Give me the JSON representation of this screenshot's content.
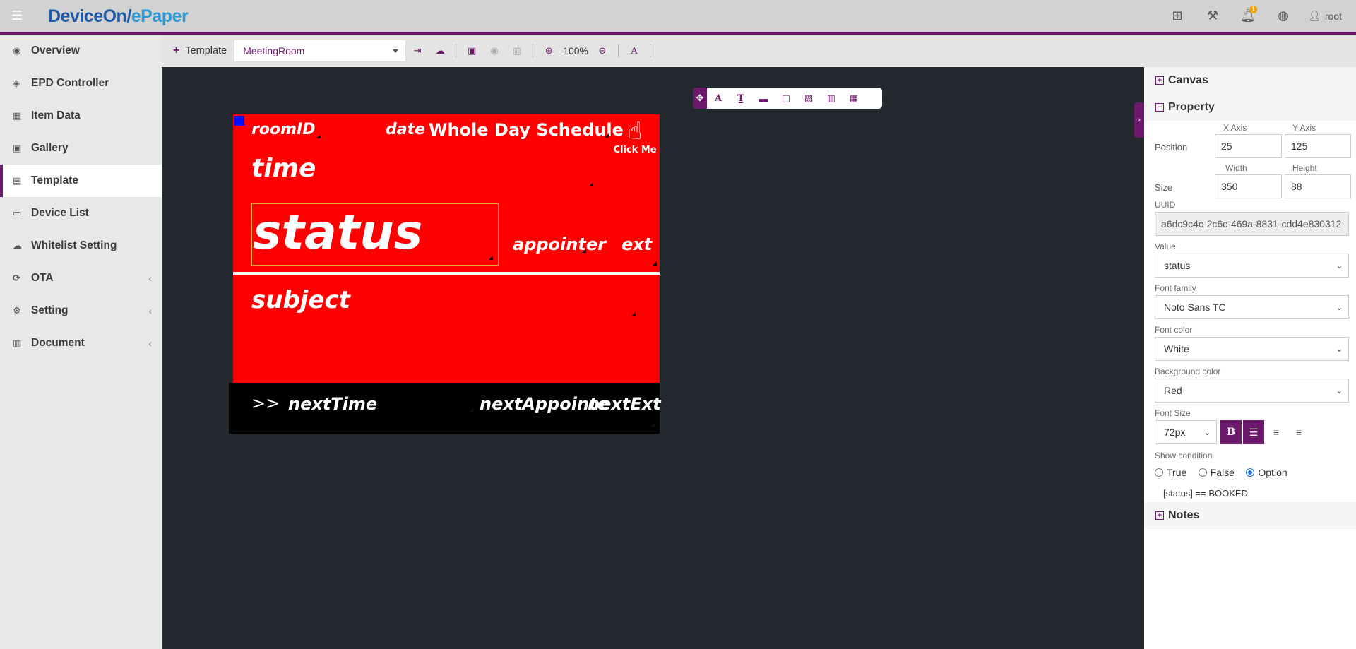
{
  "brand": {
    "part1": "DeviceOn/",
    "part2": "ePaper"
  },
  "topbar": {
    "notification_count": "1",
    "user": "root"
  },
  "sidebar": {
    "items": [
      {
        "label": "Overview"
      },
      {
        "label": "EPD Controller"
      },
      {
        "label": "Item Data"
      },
      {
        "label": "Gallery"
      },
      {
        "label": "Template"
      },
      {
        "label": "Device List"
      },
      {
        "label": "Whitelist Setting"
      },
      {
        "label": "OTA"
      },
      {
        "label": "Setting"
      },
      {
        "label": "Document"
      }
    ],
    "active": "Template"
  },
  "toolbar": {
    "template_label": "Template",
    "template_value": "MeetingRoom",
    "zoom": "100%"
  },
  "epaper": {
    "room_id": "roomID",
    "date": "date",
    "schedule": "Whole Day Schedule",
    "click_me": "Click Me",
    "time": "time",
    "status": "status",
    "appointer": "appointer",
    "ext": "ext",
    "subject": "subject",
    "next_arrow": ">>",
    "next_time": "nextTime",
    "next_appointer": "nextAppointe",
    "next_ext": "nextExt",
    "colors": {
      "background": "#ff0000",
      "footer": "#000000",
      "text": "#ffffff"
    }
  },
  "panel": {
    "canvas_title": "Canvas",
    "property_title": "Property",
    "notes_title": "Notes",
    "x_axis_label": "X Axis",
    "y_axis_label": "Y Axis",
    "position_label": "Position",
    "x_value": "25",
    "y_value": "125",
    "width_label": "Width",
    "height_label": "Height",
    "size_label": "Size",
    "width_value": "350",
    "height_value": "88",
    "uuid_label": "UUID",
    "uuid_value": "a6dc9c4c-2c6c-469a-8831-cdd4e830312",
    "value_label": "Value",
    "value_value": "status",
    "font_family_label": "Font family",
    "font_family_value": "Noto Sans TC",
    "font_color_label": "Font color",
    "font_color_value": "White",
    "bg_color_label": "Background color",
    "bg_color_value": "Red",
    "font_size_label": "Font Size",
    "font_size_value": "72px",
    "show_condition_label": "Show condition",
    "radio_true": "True",
    "radio_false": "False",
    "radio_option": "Option",
    "condition": "[status] == BOOKED"
  },
  "accent_color": "#6b1a6b"
}
